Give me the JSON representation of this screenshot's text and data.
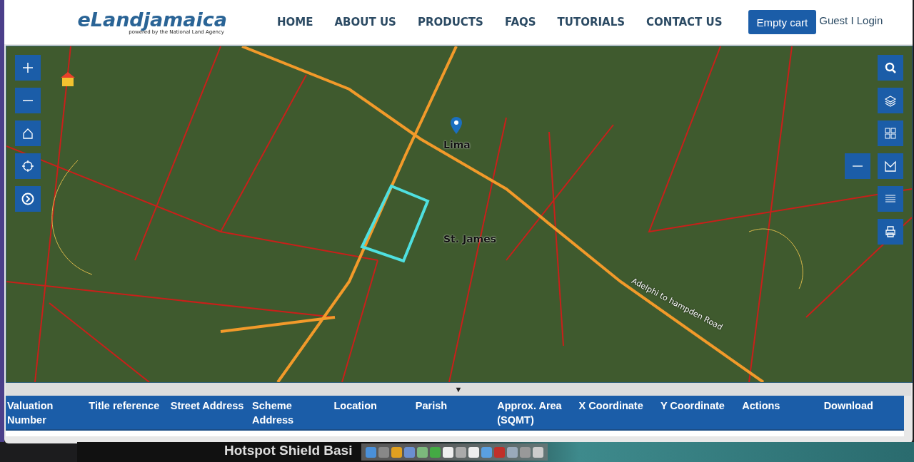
{
  "header": {
    "logo": "eLandjamaica",
    "tagline": "powered by the National Land Agency",
    "nav": [
      {
        "label": "HOME"
      },
      {
        "label": "ABOUT US"
      },
      {
        "label": "PRODUCTS"
      },
      {
        "label": "FAQS"
      },
      {
        "label": "TUTORIALS"
      },
      {
        "label": "CONTACT US"
      }
    ],
    "cart_button": "Empty cart",
    "user": "Guest I Login"
  },
  "map": {
    "labels": [
      {
        "kind": "place",
        "text": "Lima"
      },
      {
        "kind": "place",
        "text": "St. James"
      },
      {
        "kind": "road",
        "text": "Adelphi to hampden Road"
      }
    ]
  },
  "collapse_toggle": "▼",
  "table": {
    "columns": [
      "Valuation Number",
      "Title reference",
      "Street Address",
      "Scheme Address",
      "Location",
      "Parish",
      "Approx. Area (SQMT)",
      "X Coordinate",
      "Y Coordinate",
      "Actions",
      "Download"
    ]
  },
  "desktop": {
    "app_title": "Hotspot Shield Basi"
  }
}
